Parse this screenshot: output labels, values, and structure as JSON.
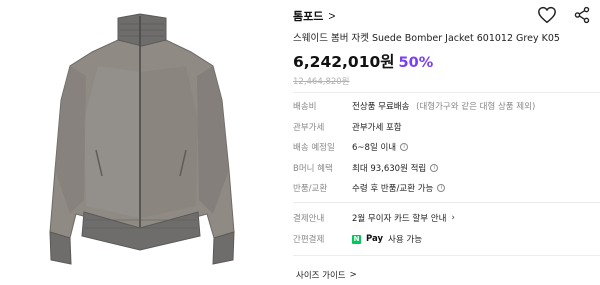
{
  "brand": {
    "name": "톰포드",
    "chevron": ">"
  },
  "actions": {
    "wishlist_icon": "heart-icon",
    "share_icon": "share-icon"
  },
  "product": {
    "title": "스웨이드 봄버 자켓 Suede Bomber Jacket 601012 Grey K05",
    "price": "6,242,010원",
    "discount": "50%",
    "original_price": "12,464,820원",
    "image_alt": "Grey suede bomber jacket"
  },
  "specs": [
    {
      "label": "배송비",
      "value": "전상품 무료배송",
      "sub": "(대형가구와 같은 대형 상품 제외)"
    },
    {
      "label": "관부가세",
      "value": "관부가세 포함"
    },
    {
      "label": "배송 예정일",
      "value": "6~8일 이내",
      "info": "i"
    },
    {
      "label": "B머니 혜택",
      "value": "최대 93,630원 적립",
      "info": "i"
    },
    {
      "label": "반품/교환",
      "value": "수령 후 반품/교환 가능",
      "info": "i"
    }
  ],
  "payment": {
    "installment_label": "결제안내",
    "installment_value": "2월 무이자 카드 할부 안내",
    "easy_pay_label": "간편결제",
    "npay_badge": "N",
    "pay_text": "Pay",
    "easy_pay_value": "사용 가능"
  },
  "size_guide": {
    "label": "사이즈 가이드",
    "chevron": ">"
  },
  "colors": {
    "accent": "#7a3ff0",
    "npay": "#03c75a",
    "jacket": "#8f8a84",
    "rib": "#6f6d6b"
  }
}
